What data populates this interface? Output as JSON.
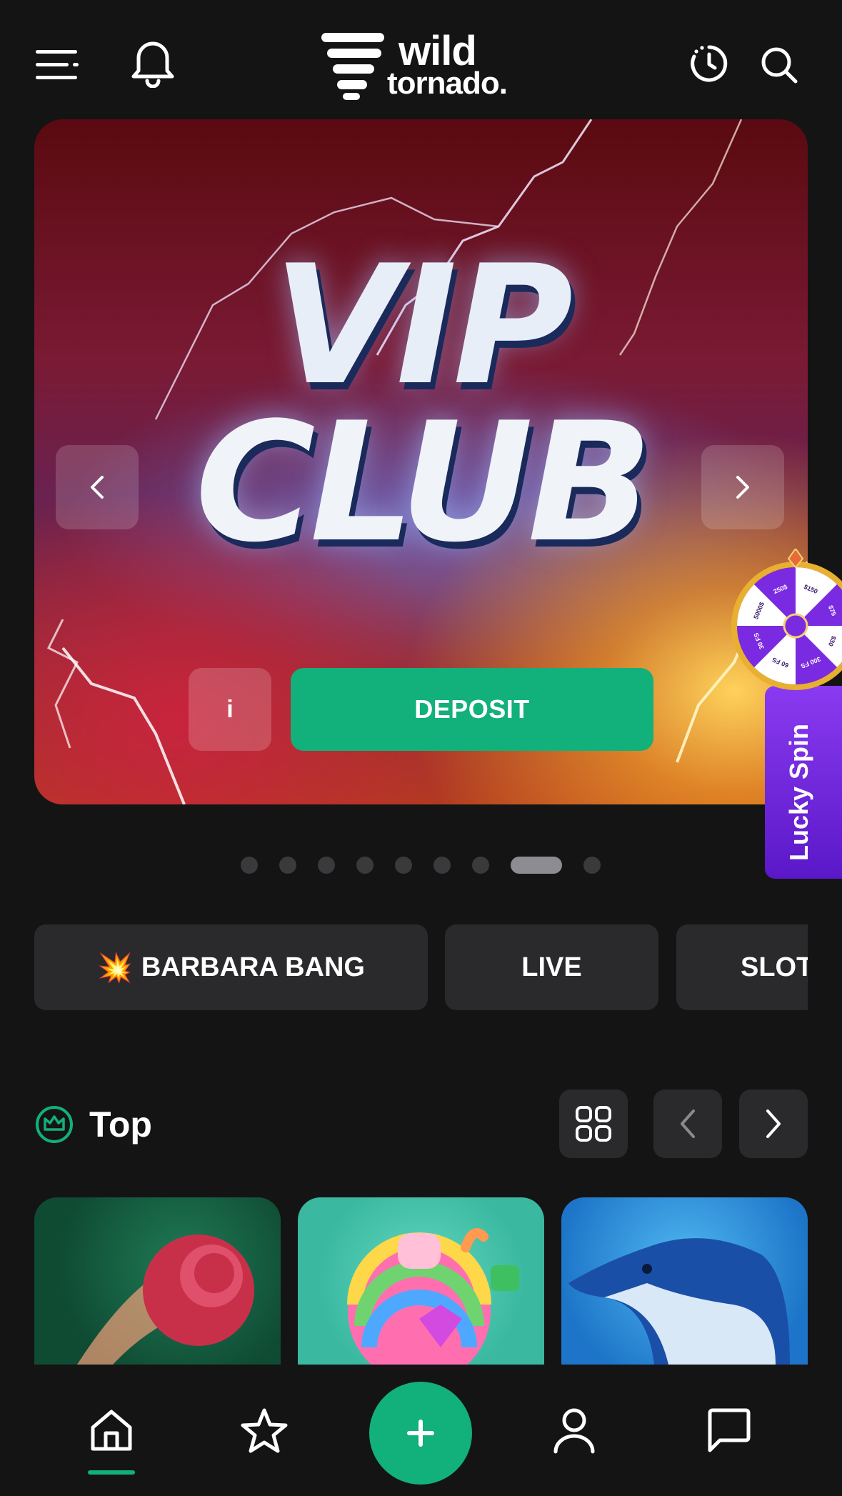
{
  "header": {
    "logo_line1": "wild",
    "logo_line2": "tornado."
  },
  "hero": {
    "title_line1": "VIP",
    "title_line2": "CLUB",
    "info_label": "i",
    "deposit_label": "DEPOSIT",
    "slide_count": 9,
    "active_slide": 8
  },
  "lucky_spin": {
    "label": "Lucky Spin",
    "segments": [
      "$150",
      "$75",
      "$30",
      "300 FS",
      "60 FS",
      "30 FS",
      "5000$",
      "250$"
    ]
  },
  "categories": [
    {
      "icon": "explosion-emoji",
      "emoji": "💥",
      "label": "BARBARA BANG"
    },
    {
      "label": "LIVE"
    },
    {
      "label": "SLOT"
    }
  ],
  "top_section": {
    "title": "Top"
  },
  "colors": {
    "accent": "#12b07a",
    "background": "#141414",
    "pill": "#2a2a2c",
    "lucky_purple": "#7a2ae0"
  }
}
